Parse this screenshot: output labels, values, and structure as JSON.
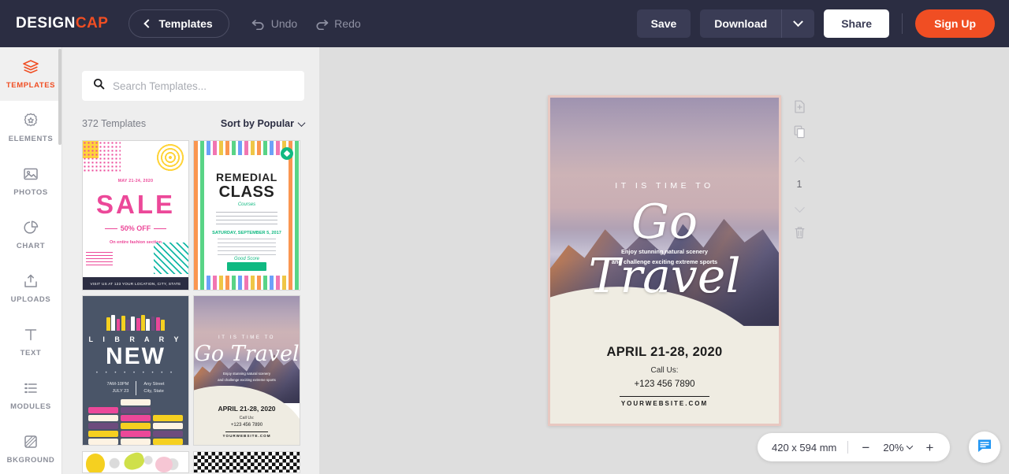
{
  "header": {
    "logo_design": "DESIGN",
    "logo_cap": "CAP",
    "templates_button": "Templates",
    "back_icon": "chevron-left-icon",
    "undo_label": "Undo",
    "undo_icon": "undo-arrow-icon",
    "redo_label": "Redo",
    "redo_icon": "redo-arrow-icon",
    "save_label": "Save",
    "download_label": "Download",
    "download_caret_icon": "chevron-down-icon",
    "share_label": "Share",
    "signup_label": "Sign Up",
    "brand_accent": "#f04e23",
    "bar_color": "#2b2d42"
  },
  "rail": {
    "items": [
      {
        "label": "TEMPLATES",
        "icon": "layers-icon",
        "active": true
      },
      {
        "label": "ELEMENTS",
        "icon": "badge-star-icon",
        "active": false
      },
      {
        "label": "PHOTOS",
        "icon": "image-icon",
        "active": false
      },
      {
        "label": "CHART",
        "icon": "pie-chart-icon",
        "active": false
      },
      {
        "label": "UPLOADS",
        "icon": "upload-icon",
        "active": false
      },
      {
        "label": "TEXT",
        "icon": "text-t-icon",
        "active": false
      },
      {
        "label": "MODULES",
        "icon": "list-icon",
        "active": false
      },
      {
        "label": "BKGROUND",
        "icon": "background-icon",
        "active": false
      }
    ]
  },
  "panel": {
    "search_placeholder": "Search Templates...",
    "search_value": "",
    "search_icon": "search-icon",
    "template_count": "372 Templates",
    "sort_label": "Sort by Popular",
    "sort_caret_icon": "chevron-down-icon",
    "templates": [
      {
        "name": "sale-poster",
        "date": "MAY 21-24, 2020",
        "headline": "SALE",
        "discount": "50% OFF",
        "subtitle": "On entire fashion section",
        "footer": "VISIT US AT 123 YOUR LOCATION, CITY, STATE"
      },
      {
        "name": "remedial-class-poster",
        "line1": "REMEDIAL",
        "line2": "CLASS",
        "script": "Courses",
        "date": "SATURDAY, SEPTEMBER 5, 2017",
        "script2": "Good Score",
        "badge_icon": "diamond-badge-icon"
      },
      {
        "name": "library-new-poster",
        "kicker": "L I B R A R Y",
        "headline": "NEW",
        "dots": "• • • • • • • • •",
        "time": "7AM-10PM",
        "date": "JULY 23",
        "street": "Any Street",
        "city": "City, State"
      },
      {
        "name": "go-travel-poster",
        "kicker": "IT IS TIME TO",
        "title": "Go Travel",
        "sub_line1": "Enjoy stunning natural scenery",
        "sub_line2": "and challenge exciting extreme sports",
        "date": "APRIL 21-28, 2020",
        "call_us": "Call Us:",
        "phone": "+123 456 7890",
        "website": "YOURWEBSITE.COM"
      },
      {
        "name": "produce-sketch-poster"
      },
      {
        "name": "chevron-pattern-poster"
      }
    ]
  },
  "canvas": {
    "poster": {
      "kicker": "IT IS TIME TO",
      "title": "Go Travel",
      "sub_line1": "Enjoy stunning natural scenery",
      "sub_line2": "and challenge exciting extreme sports",
      "date": "APRIL 21-28, 2020",
      "call_us": "Call Us:",
      "phone": "+123 456 7890",
      "website": "YOURWEBSITE.COM"
    },
    "page_tools": {
      "add_page_icon": "add-page-icon",
      "duplicate_page_icon": "duplicate-page-icon",
      "move_up_icon": "chevron-up-icon",
      "page_number": "1",
      "move_down_icon": "chevron-down-icon",
      "delete_icon": "trash-icon"
    },
    "zoom_bar": {
      "canvas_size": "420 x 594 mm",
      "zoom_out": "−",
      "zoom_level": "20%",
      "zoom_caret_icon": "chevron-down-icon",
      "zoom_in": "+"
    },
    "chat_icon": "chat-bubble-icon",
    "chat_color": "#2196f3",
    "background": "#dedede"
  }
}
